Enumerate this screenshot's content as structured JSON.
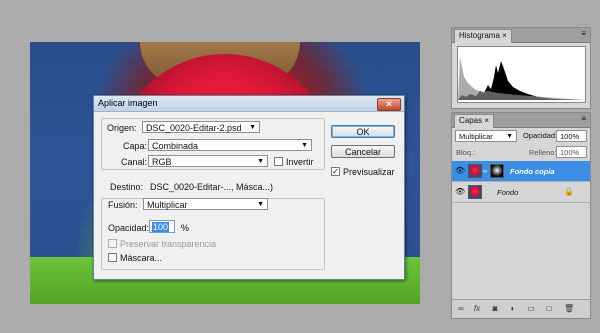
{
  "dialog": {
    "title": "Aplicar imagen",
    "close_glyph": "✕",
    "origen_label": "Origen:",
    "origen_value": "DSC_0020-Editar-2.psd",
    "capa_label": "Capa:",
    "capa_value": "Combinada",
    "canal_label": "Canal:",
    "canal_value": "RGB",
    "invertir_label": "Invertir",
    "invertir_checked": false,
    "destino_label": "Destino:",
    "destino_value": "DSC_0020-Editar-..., Másca...)",
    "fusion_label": "Fusión:",
    "fusion_value": "Multiplicar",
    "opacidad_label": "Opacidad:",
    "opacidad_value": "100",
    "opacidad_unit": "%",
    "preservar_label": "Preservar transparencia",
    "mascara_label": "Máscara...",
    "ok_label": "OK",
    "cancel_label": "Cancelar",
    "previsualizar_label": "Previsualizar",
    "previsualizar_checked": true
  },
  "histogram_panel": {
    "tab_label": "Histograma ×"
  },
  "layers_panel": {
    "tab_label": "Capas ×",
    "blend_mode": "Multiplicar",
    "opacity_label": "Opacidad:",
    "opacity_value": "100%",
    "lock_label": "Bloq.:",
    "fill_label": "Relleno:",
    "fill_value": "100%",
    "layers": [
      {
        "name": "Fondo copia",
        "selected": true,
        "has_mask": true
      },
      {
        "name": "Fondo",
        "selected": false,
        "has_mask": false,
        "locked": true
      }
    ]
  },
  "colors": {
    "selection": "#3a8ee6",
    "background": "#acacac"
  }
}
